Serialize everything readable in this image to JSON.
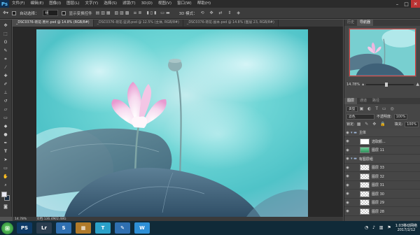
{
  "menubar": {
    "logo": "Ps",
    "items": [
      "文件(F)",
      "编辑(E)",
      "图像(I)",
      "图层(L)",
      "文字(Y)",
      "选择(S)",
      "滤镜(T)",
      "3D(D)",
      "视图(V)",
      "窗口(W)",
      "帮助(H)"
    ],
    "window_controls": [
      "–",
      "□",
      "✕"
    ]
  },
  "options": {
    "auto_select_label": "自动选择：",
    "auto_select_value": "组",
    "transform_label": "显示变换控件",
    "mode_label": "3D 模式："
  },
  "tabs": [
    {
      "label": "_DSC0376-荷花·原片.psd @ 14.8% (RGB/8#)",
      "active": true
    },
    {
      "label": "_DSC0376-荷花·蓝调.psd @ 12.5% (主体, RGB/8#)",
      "active": false
    },
    {
      "label": "_DSC0376-荷花·副本.psd @ 14.8% (图层 23, RGB/8#)",
      "active": false
    }
  ],
  "status": {
    "zoom": "14.78%",
    "doc": "文档:136.4M/2.48G"
  },
  "panels": {
    "top_tabs": [
      "历史",
      "导航器"
    ],
    "zoom": "14.78%"
  },
  "layers_panel": {
    "tabs": [
      "图层",
      "通道",
      "路径"
    ],
    "kind_label": "类型",
    "blend_mode": "滤色",
    "opacity_label": "不透明度:",
    "opacity_value": "100%",
    "lock_label": "锁定:",
    "fill_label": "填充:",
    "fill_value": "100%",
    "layers": [
      {
        "name": "主体",
        "type": "group",
        "depth": 0
      },
      {
        "name": "选取颜...",
        "type": "adjust",
        "depth": 1
      },
      {
        "name": "图层 11",
        "type": "image",
        "depth": 1
      },
      {
        "name": "有图层组",
        "type": "group",
        "depth": 0
      },
      {
        "name": "图层 33",
        "type": "layer",
        "depth": 1
      },
      {
        "name": "图层 32",
        "type": "layer",
        "depth": 1
      },
      {
        "name": "图层 31",
        "type": "layer",
        "depth": 1
      },
      {
        "name": "图层 30",
        "type": "layer",
        "depth": 1
      },
      {
        "name": "图层 29",
        "type": "layer",
        "depth": 1
      },
      {
        "name": "图层 28",
        "type": "layer",
        "depth": 1
      }
    ]
  },
  "taskbar": {
    "apps": [
      {
        "name": "PS",
        "color": "#0e3a66"
      },
      {
        "name": "Lr",
        "color": "#2b3d4f"
      },
      {
        "name": "S",
        "color": "#2f6fb0"
      },
      {
        "name": "▦",
        "color": "#b07a2a"
      },
      {
        "name": "T",
        "color": "#2aa0c8"
      },
      {
        "name": "✎",
        "color": "#2f6fb0"
      },
      {
        "name": "W",
        "color": "#2e8fd6"
      }
    ],
    "clock_time": "1:03移动网络",
    "clock_date": "2017/2/12"
  }
}
